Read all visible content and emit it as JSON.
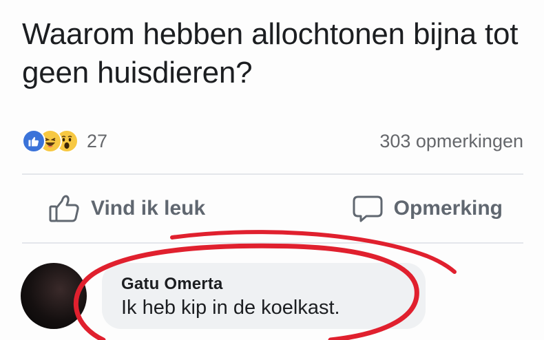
{
  "post": {
    "text": "Waarom hebben allochtonen bijna tot geen huisdieren?"
  },
  "stats": {
    "reaction_icons": [
      "like-icon",
      "haha-icon",
      "wow-icon"
    ],
    "reaction_count": "27",
    "comments_count": "303 opmerkingen"
  },
  "actions": {
    "like_label": "Vind ik leuk",
    "comment_label": "Opmerking"
  },
  "comment": {
    "author": "Gatu Omerta",
    "text": "Ik heb kip in de koelkast."
  },
  "colors": {
    "like_blue": "#3b73d9",
    "emoji_yellow": "#f7c842",
    "highlight_red": "#e0202e",
    "bubble_bg": "#eff1f3",
    "muted_text": "#65676b"
  }
}
